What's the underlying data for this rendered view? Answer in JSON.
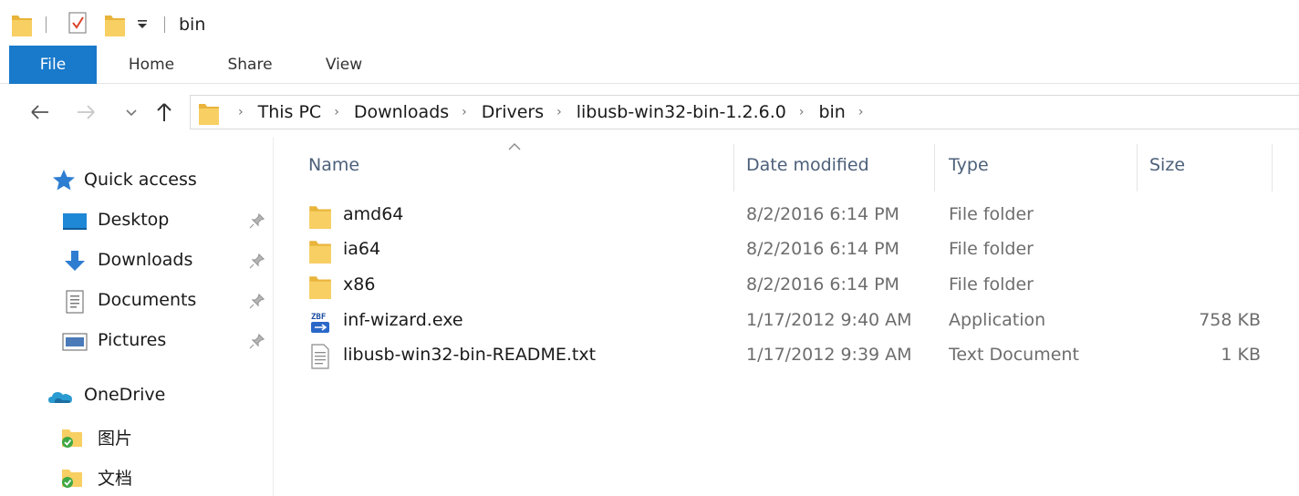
{
  "window": {
    "title": "bin",
    "qat": {
      "folder_icon": "folder-icon",
      "properties_icon": "properties-check-icon",
      "new_folder_icon": "new-folder-icon",
      "dropdown_icon": "customize-dropdown-icon"
    }
  },
  "ribbon": {
    "tabs": [
      {
        "label": "File"
      },
      {
        "label": "Home"
      },
      {
        "label": "Share"
      },
      {
        "label": "View"
      }
    ],
    "active_color": "#1979ca"
  },
  "navigation": {
    "back_icon": "back-arrow-icon",
    "forward_icon": "forward-arrow-icon",
    "recent_icon": "chevron-down-icon",
    "up_icon": "up-arrow-icon"
  },
  "address_bar": {
    "breadcrumbs": [
      "This PC",
      "Downloads",
      "Drivers",
      "libusb-win32-bin-1.2.6.0",
      "bin"
    ],
    "separator": "›"
  },
  "sidebar": {
    "sections": [
      {
        "label": "Quick access",
        "icon": "star-icon"
      },
      {
        "label": "Desktop",
        "icon": "desktop-icon",
        "pinned": true
      },
      {
        "label": "Downloads",
        "icon": "download-icon",
        "pinned": true
      },
      {
        "label": "Documents",
        "icon": "documents-icon",
        "pinned": true
      },
      {
        "label": "Pictures",
        "icon": "pictures-icon",
        "pinned": true
      },
      {
        "label": "OneDrive",
        "icon": "onedrive-icon"
      },
      {
        "label": "图片",
        "icon": "synced-folder-icon"
      },
      {
        "label": "文档",
        "icon": "synced-folder-icon"
      }
    ]
  },
  "file_list": {
    "columns": {
      "name": "Name",
      "date": "Date modified",
      "type": "Type",
      "size": "Size"
    },
    "sort_indicator": "^",
    "rows": [
      {
        "name": "amd64",
        "date": "8/2/2016 6:14 PM",
        "type": "File folder",
        "size": "",
        "icon": "folder-icon"
      },
      {
        "name": "ia64",
        "date": "8/2/2016 6:14 PM",
        "type": "File folder",
        "size": "",
        "icon": "folder-icon"
      },
      {
        "name": "x86",
        "date": "8/2/2016 6:14 PM",
        "type": "File folder",
        "size": "",
        "icon": "folder-icon"
      },
      {
        "name": "inf-wizard.exe",
        "date": "1/17/2012 9:40 AM",
        "type": "Application",
        "size": "758 KB",
        "icon": "application-exe-icon"
      },
      {
        "name": "libusb-win32-bin-README.txt",
        "date": "1/17/2012 9:39 AM",
        "type": "Text Document",
        "size": "1 KB",
        "icon": "text-document-icon"
      }
    ]
  },
  "colors": {
    "folder": "#f5c451",
    "header_text": "#4c607a",
    "secondary_text": "#6d6d6d",
    "accent": "#1979ca"
  }
}
